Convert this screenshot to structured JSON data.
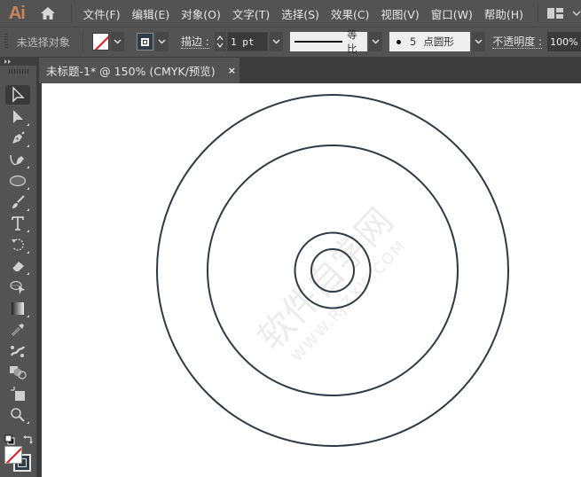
{
  "app": {
    "logo": "Ai"
  },
  "menu": {
    "items": [
      "文件(F)",
      "编辑(E)",
      "对象(O)",
      "文字(T)",
      "选择(S)",
      "效果(C)",
      "视图(V)",
      "窗口(W)",
      "帮助(H)"
    ]
  },
  "control_bar": {
    "selection_status": "未选择对象",
    "stroke_label": "描边",
    "stroke_weight": "1 pt",
    "variable_width_profile": "等比",
    "brush_size": "5",
    "brush_definition": "点圆形",
    "opacity_label": "不透明度",
    "opacity_value": "100%",
    "fill_color": "none",
    "stroke_color": "#2f3d48"
  },
  "document_tab": {
    "title": "未标题-1* @ 150% (CMYK/预览)",
    "close_icon": "×"
  },
  "tools": [
    {
      "name": "selection-tool",
      "active": true
    },
    {
      "name": "direct-selection-tool"
    },
    {
      "name": "pen-tool"
    },
    {
      "name": "curvature-tool"
    },
    {
      "name": "ellipse-tool"
    },
    {
      "name": "paintbrush-tool"
    },
    {
      "name": "type-tool",
      "glyph": "T"
    },
    {
      "name": "rotate-tool"
    },
    {
      "name": "eraser-tool"
    },
    {
      "name": "lasso-select-tool"
    },
    {
      "name": "gradient-tool"
    },
    {
      "name": "eyedropper-tool"
    },
    {
      "name": "puppet-warp-tool"
    },
    {
      "name": "shape-builder-tool"
    },
    {
      "name": "artboard-tool"
    },
    {
      "name": "zoom-tool"
    }
  ],
  "artwork": {
    "shape": "concentric-circles",
    "stroke_color": "#2f3a45",
    "circle_count": 4
  },
  "watermark": {
    "line1": "软件自学网",
    "line2": "WWW.RJZXW.COM"
  }
}
